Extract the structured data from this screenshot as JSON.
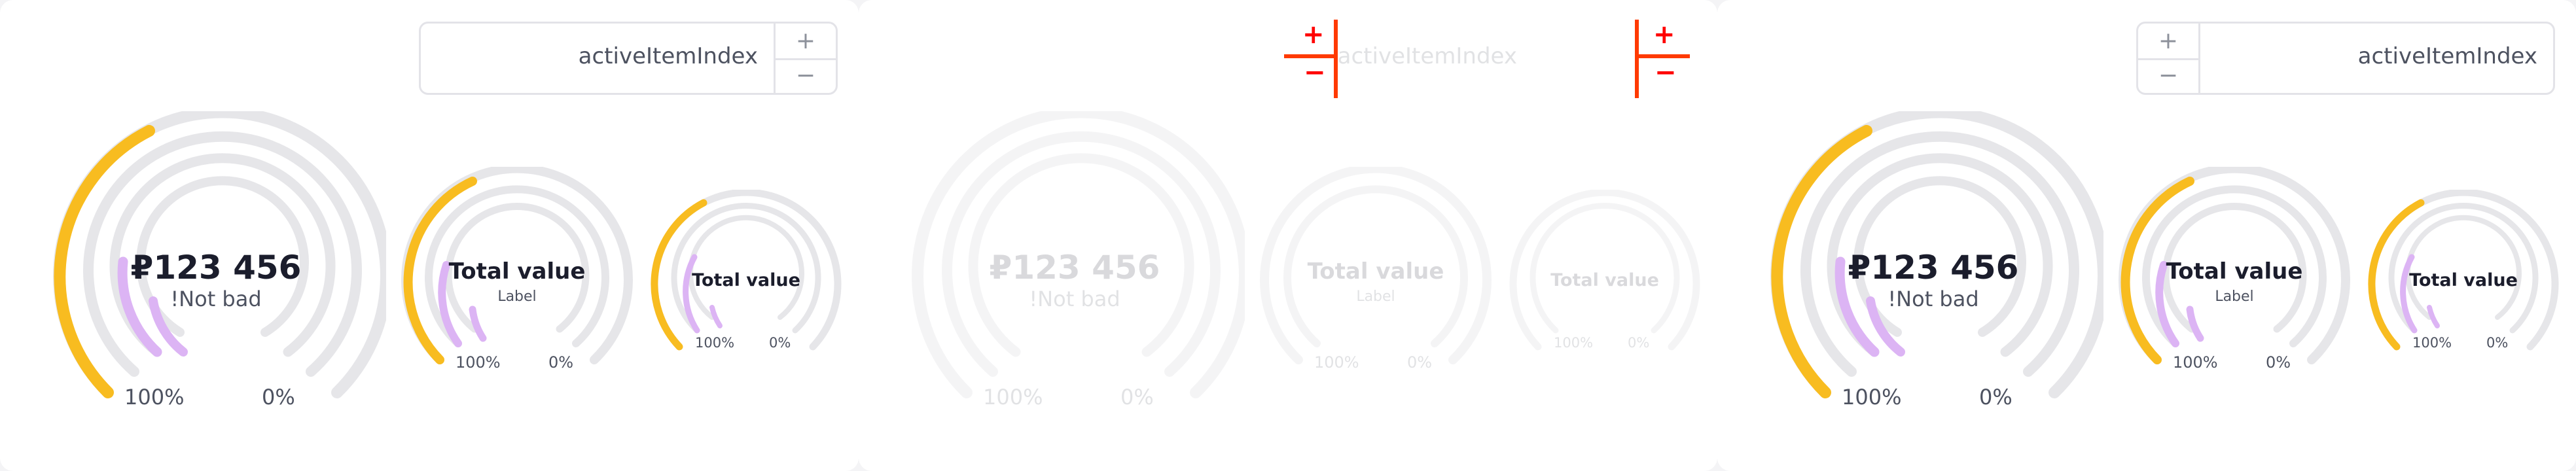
{
  "stepper": {
    "field_value": "activeItemIndex",
    "plus": "+",
    "minus": "−"
  },
  "gauges": {
    "large": {
      "value": "₽123 456",
      "label": "!Not bad",
      "min_label": "100%",
      "max_label": "0%"
    },
    "medium": {
      "value": "Total value",
      "label": "Label",
      "min_label": "100%",
      "max_label": "0%"
    },
    "small": {
      "value": "Total value",
      "min_label": "100%",
      "max_label": "0%"
    }
  },
  "colors": {
    "accent_yellow": "#f8bc20",
    "accent_lilac": "#dcb4f4",
    "track_gray": "#e6e6e9",
    "marker_red": "#ff3a00"
  },
  "icons": [
    "plus-icon",
    "minus-icon"
  ]
}
